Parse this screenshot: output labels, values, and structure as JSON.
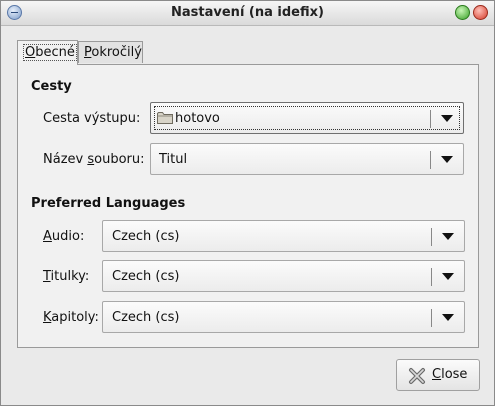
{
  "window": {
    "title": "Nastavení (na idefix)"
  },
  "tabs": [
    {
      "label": "Obecné",
      "mnemonic": "O",
      "rest": "becné"
    },
    {
      "label": "Pokročilý",
      "mnemonic": "P",
      "rest": "okročilý"
    }
  ],
  "cesty": {
    "heading": "Cesty",
    "output_label": "Cesta výstupu:",
    "output_value": "hotovo",
    "output_icon": "folder-icon",
    "filename_label_pre": "Název ",
    "filename_label_mn": "s",
    "filename_label_post": "ouboru:",
    "filename_value": "Titul"
  },
  "languages": {
    "heading": "Preferred Languages",
    "audio_mn": "A",
    "audio_rest": "udio:",
    "audio_value": "Czech (cs)",
    "subs_mn": "T",
    "subs_rest": "itulky:",
    "subs_value": "Czech (cs)",
    "chapters_mn": "K",
    "chapters_rest": "apitoly:",
    "chapters_value": "Czech (cs)"
  },
  "buttons": {
    "close_mn": "C",
    "close_rest": "lose",
    "close_icon": "close-icon"
  }
}
